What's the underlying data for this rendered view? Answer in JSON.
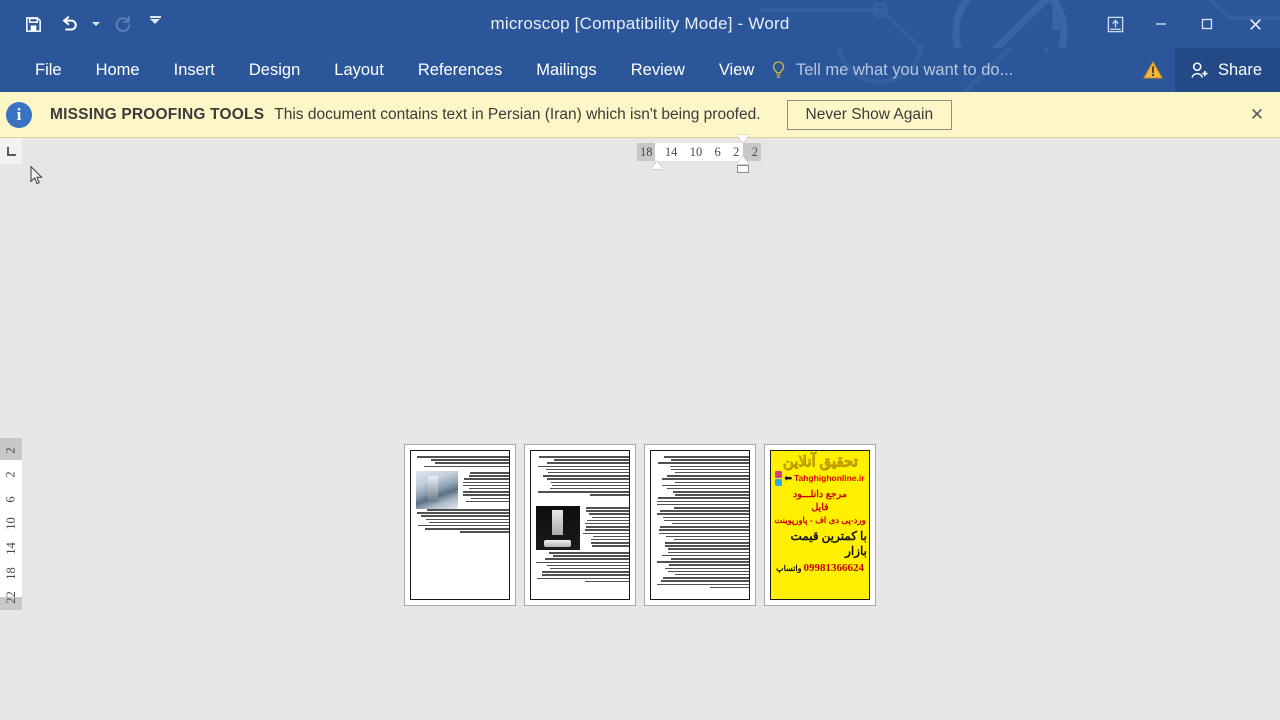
{
  "window": {
    "title": "microscop [Compatibility Mode] - Word",
    "quick_access": [
      {
        "name": "save-icon",
        "label": "Save"
      },
      {
        "name": "undo-icon",
        "label": "Undo"
      },
      {
        "name": "redo-icon",
        "label": "Repeat"
      },
      {
        "name": "customize-qat-icon",
        "label": "Customize Quick Access Toolbar"
      }
    ],
    "controls": {
      "ribbon_display_options": "Ribbon Display Options",
      "minimize": "—",
      "restore": "❐",
      "close": "✕"
    }
  },
  "ribbon": {
    "tabs": [
      {
        "label": "File"
      },
      {
        "label": "Home"
      },
      {
        "label": "Insert"
      },
      {
        "label": "Design"
      },
      {
        "label": "Layout"
      },
      {
        "label": "References"
      },
      {
        "label": "Mailings"
      },
      {
        "label": "Review"
      },
      {
        "label": "View"
      }
    ],
    "tell_me": "Tell me what you want to do...",
    "warning_label": "!",
    "share_label": "Share",
    "active_tab": "View",
    "accent_color": "#2b579a",
    "share_bg": "#234a87"
  },
  "notification": {
    "icon": "i",
    "title": "MISSING PROOFING TOOLS",
    "message": "This document contains text in Persian (Iran) which isn't being proofed.",
    "button_label": "Never Show Again",
    "close_label": "✕",
    "background": "#fdf7c8"
  },
  "rulers": {
    "tab_selector": "L",
    "horizontal_marks": [
      "18",
      "14",
      "10",
      "6",
      "2",
      "2"
    ],
    "vertical_marks": [
      "2",
      "2",
      "6",
      "10",
      "14",
      "18",
      "22"
    ]
  },
  "document": {
    "zoom_view": "multiple-pages",
    "pages": [
      {
        "index": 1,
        "type": "text-with-image",
        "image": "lab-microscope-photo"
      },
      {
        "index": 2,
        "type": "text-with-image",
        "image": "dark-microscope-photo"
      },
      {
        "index": 3,
        "type": "text-only",
        "image": ""
      },
      {
        "index": 4,
        "type": "advertisement",
        "image": ""
      }
    ],
    "ad_page": {
      "heading_line1": "تحقیق آنلاین",
      "url": "Tahghighonline.ir",
      "line1": "مرجع دانلـــود",
      "line2": "فایل",
      "line3": "ورد-پی دی اف - پاورپوینت",
      "line4": "با کمترین قیمت بازار",
      "phone": "09981366624",
      "phone_label": "واتساپ",
      "background": "#fff000"
    }
  },
  "canvas": {
    "background": "#e6e6e6"
  }
}
